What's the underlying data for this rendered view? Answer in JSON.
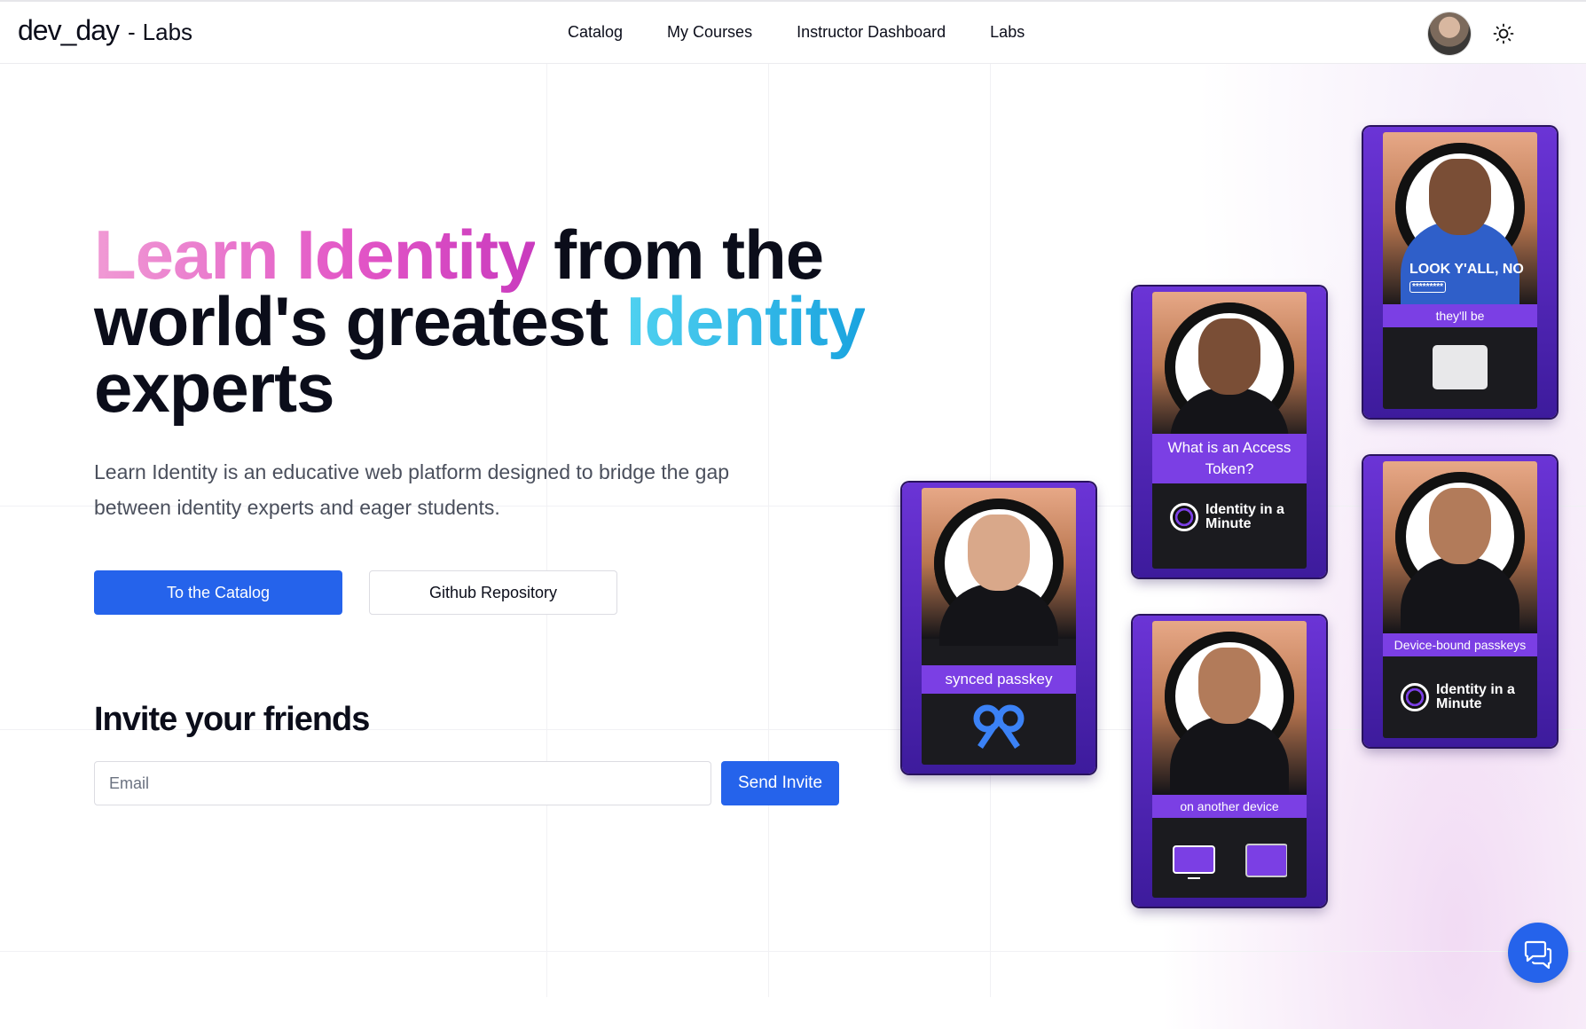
{
  "header": {
    "brand": "dev_day",
    "brand_separator": "-",
    "brand_sub": "Labs",
    "nav": [
      "Catalog",
      "My Courses",
      "Instructor Dashboard",
      "Labs"
    ],
    "theme_icon": "sun-icon"
  },
  "hero": {
    "title_part1": "Learn Identity",
    "title_part2": " from the world's greatest ",
    "title_part3": "Identity",
    "title_part4": " experts",
    "description": "Learn Identity is an educative web platform designed to bridge the gap between identity experts and eager students.",
    "primary_button": "To the Catalog",
    "secondary_button": "Github Repository"
  },
  "invite": {
    "title": "Invite your friends",
    "email_placeholder": "Email",
    "send_button": "Send Invite"
  },
  "cards": {
    "synced": {
      "caption": "synced passkey"
    },
    "access_token": {
      "caption": "What is an Access Token?",
      "brand": "Identity in a Minute"
    },
    "another_device": {
      "caption": "on another device"
    },
    "look_yall": {
      "overlay_text": "LOOK Y'ALL, NO",
      "overlay_pw": "*********",
      "caption": "they'll be"
    },
    "device_bound": {
      "caption": "Device-bound passkeys",
      "brand": "Identity in a Minute"
    }
  },
  "chat": {
    "icon": "chat-bubbles-icon"
  },
  "colors": {
    "primary": "#2563eb",
    "card_purple": "#7b3fe4",
    "title_pink": "#e255c6",
    "title_blue": "#1aa3df"
  }
}
